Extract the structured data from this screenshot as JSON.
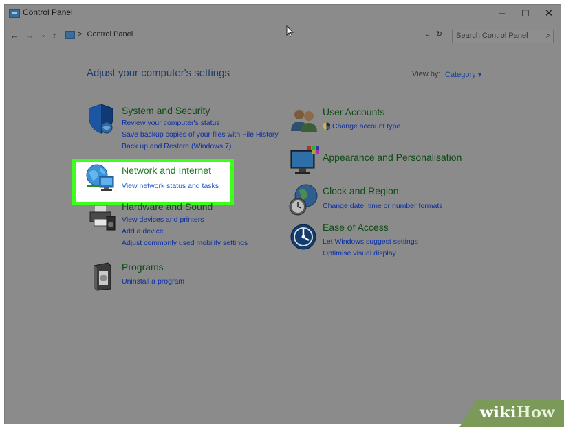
{
  "window": {
    "title": "Control Panel",
    "minimize": "–",
    "maximize": "☐",
    "close": "✕"
  },
  "address": {
    "back": "←",
    "forward": "→",
    "recent": "⌄",
    "up": "↑",
    "separator": ">",
    "path": "Control Panel",
    "dropdown": "⌄",
    "refresh": "↻",
    "search_placeholder": "Search Control Panel",
    "search_icon": "⌕"
  },
  "main": {
    "heading": "Adjust your computer's settings",
    "view_by_label": "View by:",
    "view_by_value": "Category ▾"
  },
  "left": [
    {
      "title": "System and Security",
      "icon": "shield-icon",
      "links": [
        "Review your computer's status",
        "Save backup copies of your files with File History",
        "Back up and Restore (Windows 7)"
      ]
    },
    {
      "title": "Network and Internet",
      "icon": "globe-network-icon",
      "links": [
        "View network status and tasks"
      ]
    },
    {
      "title": "Hardware and Sound",
      "icon": "printer-icon",
      "links": [
        "View devices and printers",
        "Add a device",
        "Adjust commonly used mobility settings"
      ]
    },
    {
      "title": "Programs",
      "icon": "programs-box-icon",
      "links": [
        "Uninstall a program"
      ]
    }
  ],
  "right": [
    {
      "title": "User Accounts",
      "icon": "users-icon",
      "links": [
        "Change account type"
      ]
    },
    {
      "title": "Appearance and Personalisation",
      "icon": "monitor-palette-icon",
      "links": []
    },
    {
      "title": "Clock and Region",
      "icon": "clock-globe-icon",
      "links": [
        "Change date, time or number formats"
      ]
    },
    {
      "title": "Ease of Access",
      "icon": "ease-of-access-icon",
      "links": [
        "Let Windows suggest settings",
        "Optimise visual display"
      ]
    }
  ],
  "watermark": {
    "wiki": "wiki",
    "how": "How"
  },
  "colors": {
    "highlight": "#3dff1c",
    "dim_overlay": "#8b8b8b",
    "link": "#0a2fa6",
    "category_title": "#0c4c14"
  }
}
